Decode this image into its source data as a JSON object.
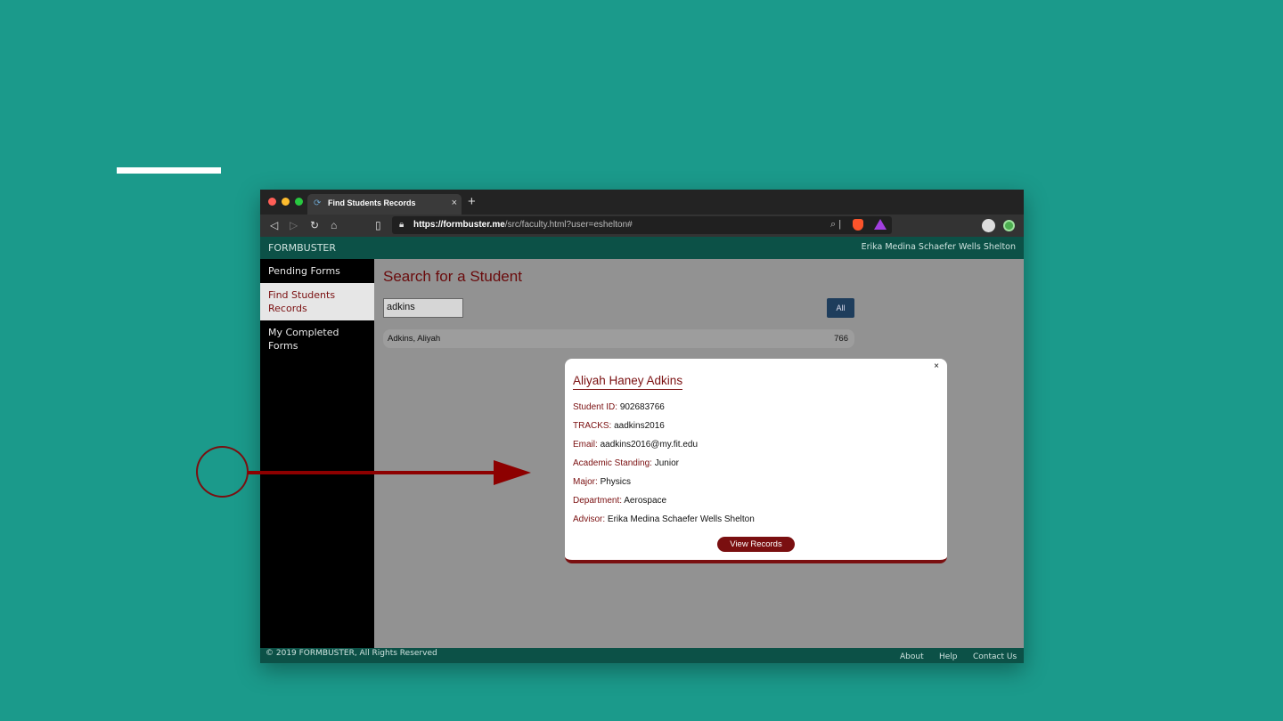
{
  "browser": {
    "tab_title": "Find Students Records",
    "tab_close": "×",
    "new_tab": "+",
    "url_domain": "https://formbuster.me",
    "url_path": "/src/faculty.html?user=eshelton#"
  },
  "header": {
    "brand": "FORMBUSTER",
    "user_name": "Erika Medina Schaefer Wells Shelton"
  },
  "sidebar": {
    "items": [
      {
        "label": "Pending Forms"
      },
      {
        "label": "Find Students Records"
      },
      {
        "label": "My Completed Forms"
      }
    ]
  },
  "main": {
    "title": "Search for a Student",
    "search_value": "adkins",
    "search_all_label": "All",
    "result_name": "Adkins, Aliyah",
    "result_id_partial": "766"
  },
  "modal": {
    "close": "×",
    "name": "Aliyah Haney Adkins",
    "fields": [
      {
        "label": "Student ID:",
        "value": "902683766"
      },
      {
        "label": "TRACKS:",
        "value": "aadkins2016"
      },
      {
        "label": "Email:",
        "value": "aadkins2016@my.fit.edu"
      },
      {
        "label": "Academic Standing:",
        "value": "Junior"
      },
      {
        "label": "Major:",
        "value": "Physics"
      },
      {
        "label": "Department:",
        "value": "Aerospace"
      },
      {
        "label": "Advisor:",
        "value": "Erika Medina Schaefer Wells Shelton"
      }
    ],
    "button_label": "View Records"
  },
  "footer": {
    "copyright": "© 2019 FORMBUSTER, All Rights Reserved",
    "links": [
      "About",
      "Help",
      "Contact Us"
    ]
  },
  "colors": {
    "background": "#1b9a8b",
    "brand_dark_teal": "#0c5147",
    "accent_maroon": "#7a0f10"
  }
}
